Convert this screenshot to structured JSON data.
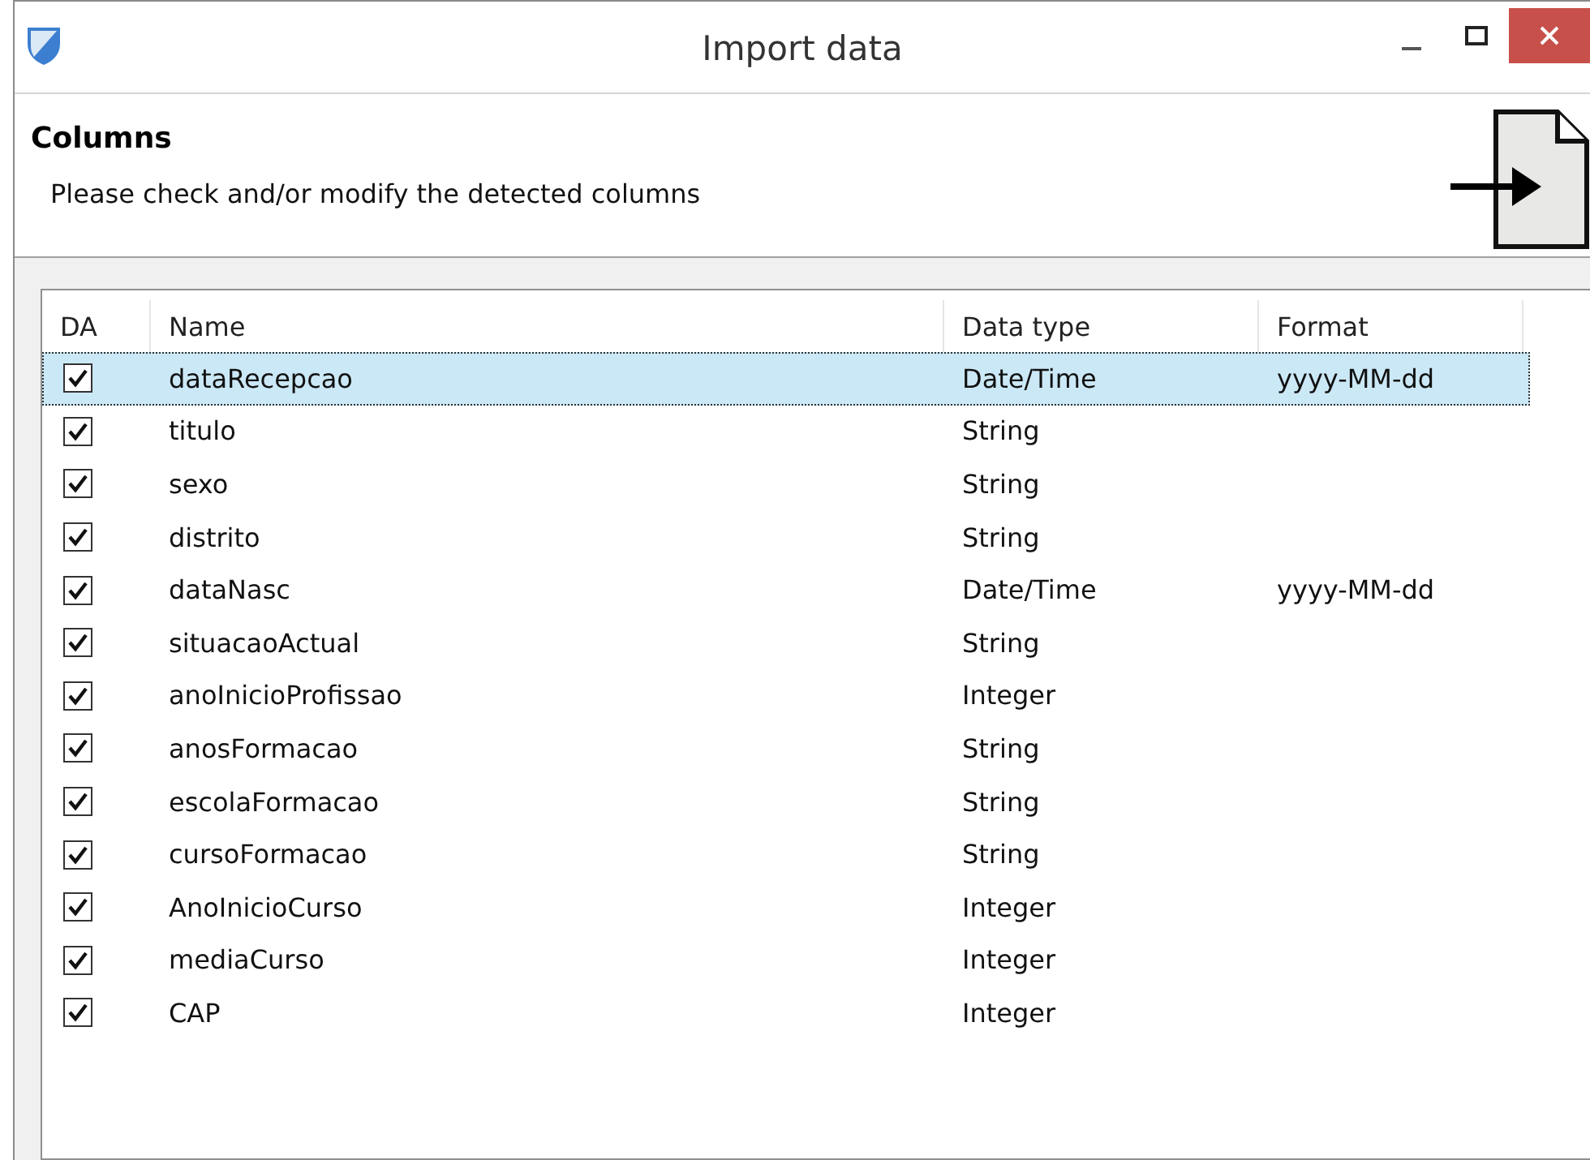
{
  "window": {
    "title": "Import data"
  },
  "header": {
    "title": "Columns",
    "subtitle": "Please check and/or modify the detected columns"
  },
  "table": {
    "columns": [
      "DA",
      "Name",
      "Data type",
      "Format"
    ],
    "rows": [
      {
        "checked": true,
        "selected": true,
        "name": "dataRecepcao",
        "type": "Date/Time",
        "format": "yyyy-MM-dd"
      },
      {
        "checked": true,
        "selected": false,
        "name": "titulo",
        "type": "String"
      },
      {
        "checked": true,
        "selected": false,
        "name": "sexo",
        "type": "String"
      },
      {
        "checked": true,
        "selected": false,
        "name": "distrito",
        "type": "String"
      },
      {
        "checked": true,
        "selected": false,
        "name": "dataNasc",
        "type": "Date/Time",
        "format": "yyyy-MM-dd"
      },
      {
        "checked": true,
        "selected": false,
        "name": "situacaoActual",
        "type": "String"
      },
      {
        "checked": true,
        "selected": false,
        "name": "anoInicioProfissao",
        "type": "Integer"
      },
      {
        "checked": true,
        "selected": false,
        "name": "anosFormacao",
        "type": "String"
      },
      {
        "checked": true,
        "selected": false,
        "name": "escolaFormacao",
        "type": "String"
      },
      {
        "checked": true,
        "selected": false,
        "name": "cursoFormacao",
        "type": "String"
      },
      {
        "checked": true,
        "selected": false,
        "name": "AnoInicioCurso",
        "type": "Integer"
      },
      {
        "checked": true,
        "selected": false,
        "name": "mediaCurso",
        "type": "Integer"
      },
      {
        "checked": true,
        "selected": false,
        "name": "CAP",
        "type": "Integer"
      }
    ]
  }
}
